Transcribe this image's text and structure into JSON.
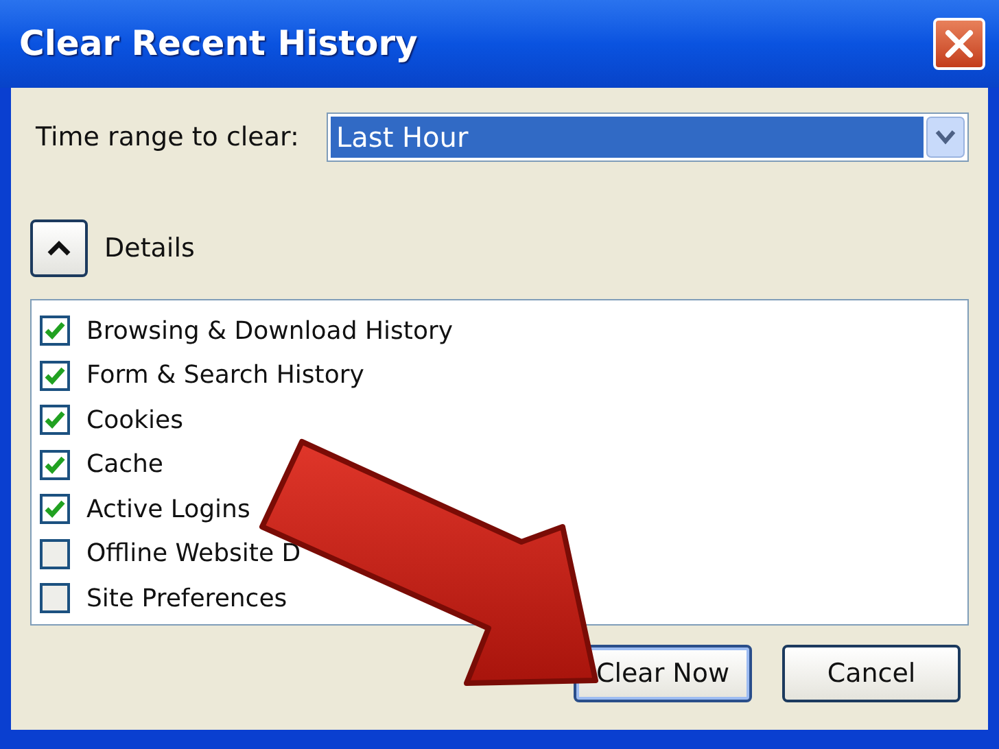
{
  "window": {
    "title": "Clear Recent History"
  },
  "time_range": {
    "label": "Time range to clear:",
    "value": "Last Hour"
  },
  "details": {
    "label": "Details",
    "expanded": true
  },
  "items": [
    {
      "label": "Browsing & Download History",
      "checked": true
    },
    {
      "label": "Form & Search History",
      "checked": true
    },
    {
      "label": "Cookies",
      "checked": true
    },
    {
      "label": "Cache",
      "checked": true
    },
    {
      "label": "Active Logins",
      "checked": true
    },
    {
      "label": "Offline Website D",
      "checked": false
    },
    {
      "label": "Site Preferences",
      "checked": false
    }
  ],
  "buttons": [
    "Clear Now",
    "Cancel"
  ]
}
